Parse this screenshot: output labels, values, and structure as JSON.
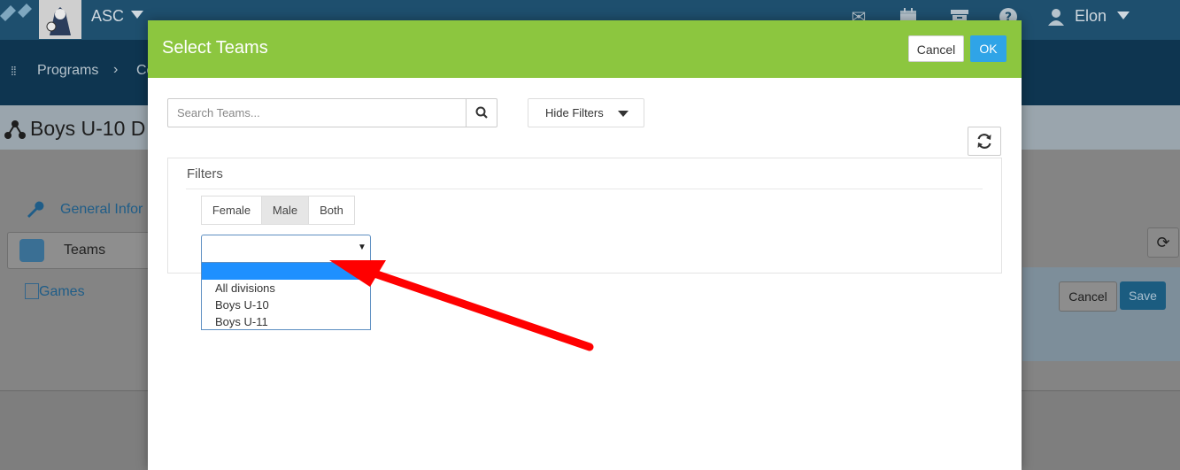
{
  "app": {
    "org_name": "ASC",
    "user_name": "Elon",
    "icons": [
      "envelope-icon",
      "calendar-icon",
      "archive-icon",
      "help-icon",
      "user-icon"
    ]
  },
  "nav": {
    "programs": "Programs",
    "crumb": "Co"
  },
  "page": {
    "title": "Boys U-10 D",
    "sidebar": {
      "general": "General Infor",
      "teams": "Teams",
      "games": "Games"
    },
    "cancel_label": "Cancel",
    "save_label": "Save"
  },
  "modal": {
    "title": "Select Teams",
    "cancel_label": "Cancel",
    "ok_label": "OK",
    "search_placeholder": "Search Teams...",
    "hide_filters_label": "Hide Filters",
    "filters_title": "Filters",
    "gender_options": [
      "Female",
      "Male",
      "Both"
    ],
    "gender_selected": "Male",
    "division_value": "",
    "division_options": [
      "",
      "All divisions",
      "Boys U-10",
      "Boys U-11"
    ]
  },
  "colors": {
    "header_green": "#8cc63f",
    "ok_blue": "#2fa4e7",
    "annotation_red": "#ff0000"
  }
}
